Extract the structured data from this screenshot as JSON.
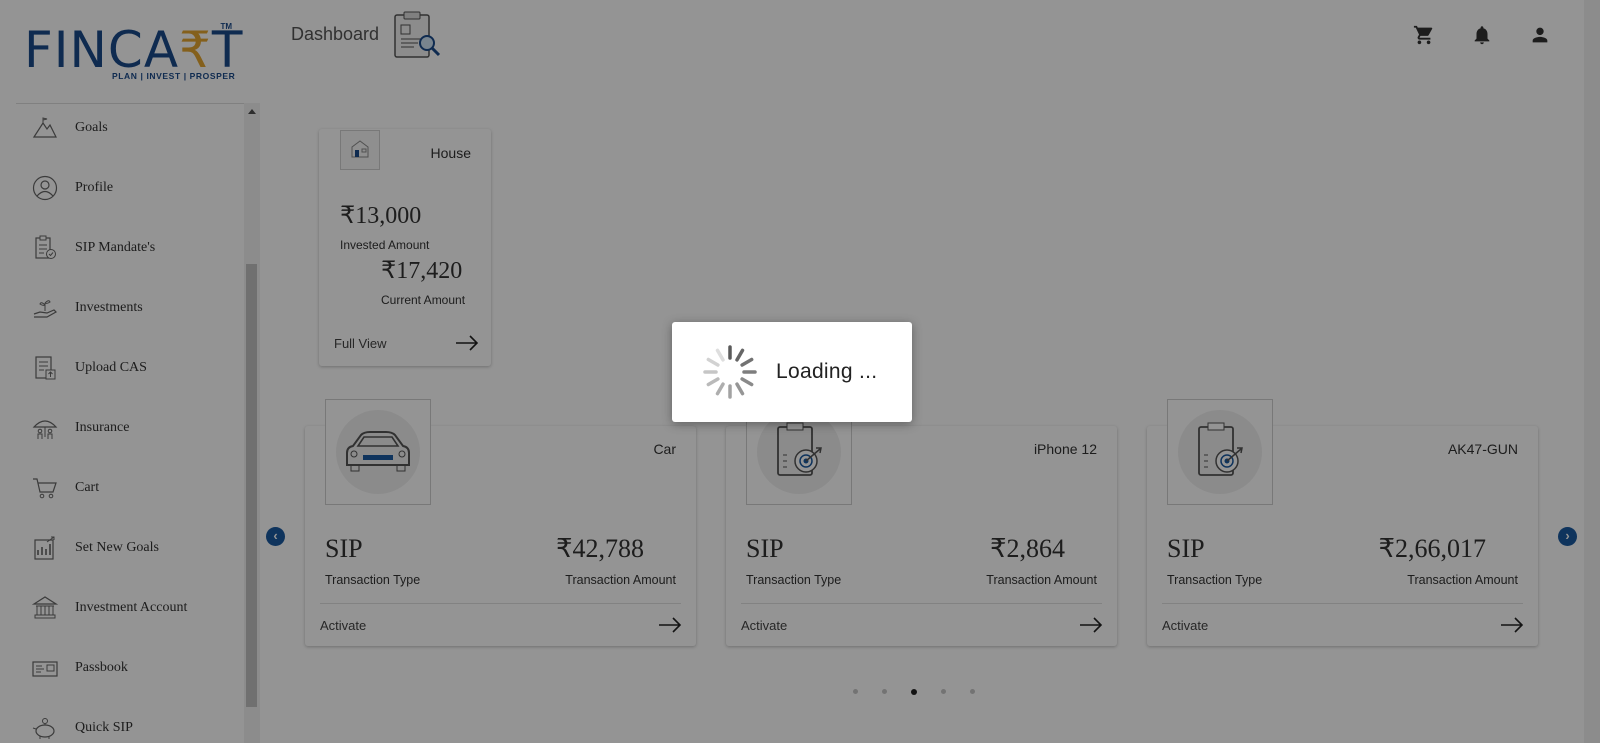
{
  "logo": {
    "brand": "FINCART",
    "tm": "TM",
    "tagline": "PLAN | INVEST | PROSPER"
  },
  "header": {
    "title": "Dashboard",
    "icons": [
      "cart-icon",
      "bell-icon",
      "account-icon"
    ]
  },
  "sidebar": {
    "items": [
      {
        "label": "Goals",
        "icon": "mountain-icon"
      },
      {
        "label": "Profile",
        "icon": "profile-icon"
      },
      {
        "label": "SIP Mandate's",
        "icon": "clipboard-check-icon"
      },
      {
        "label": "Investments",
        "icon": "hand-plant-icon"
      },
      {
        "label": "Upload CAS",
        "icon": "upload-document-icon"
      },
      {
        "label": "Insurance",
        "icon": "umbrella-family-icon"
      },
      {
        "label": "Cart",
        "icon": "cart-icon"
      },
      {
        "label": "Set New Goals",
        "icon": "goals-chart-icon"
      },
      {
        "label": "Investment Account",
        "icon": "bank-icon"
      },
      {
        "label": "Passbook",
        "icon": "passbook-icon"
      },
      {
        "label": "Quick SIP",
        "icon": "piggy-bank-icon"
      }
    ]
  },
  "house": {
    "title": "House",
    "invested": "₹13,000",
    "invested_label": "Invested Amount",
    "current": "₹17,420",
    "current_label": "Current Amount",
    "full_view": "Full View"
  },
  "goals": [
    {
      "name": "Car",
      "type": "SIP",
      "type_label": "Transaction Type",
      "amount": "₹42,788",
      "amount_label": "Transaction Amount",
      "action": "Activate",
      "icon": "car-icon"
    },
    {
      "name": "iPhone 12",
      "type": "SIP",
      "type_label": "Transaction Type",
      "amount": "₹2,864",
      "amount_label": "Transaction Amount",
      "action": "Activate",
      "icon": "clipboard-target-icon"
    },
    {
      "name": "AK47-GUN",
      "type": "SIP",
      "type_label": "Transaction Type",
      "amount": "₹2,66,017",
      "amount_label": "Transaction Amount",
      "action": "Activate",
      "icon": "clipboard-target-icon"
    }
  ],
  "carousel": {
    "dot_count": 5,
    "active_dot": 3
  },
  "loading": {
    "text": "Loading  ..."
  },
  "colors": {
    "brand_blue": "#1b4a8a",
    "brand_gold": "#e3a531",
    "nav_blue": "#1a5aa0"
  }
}
